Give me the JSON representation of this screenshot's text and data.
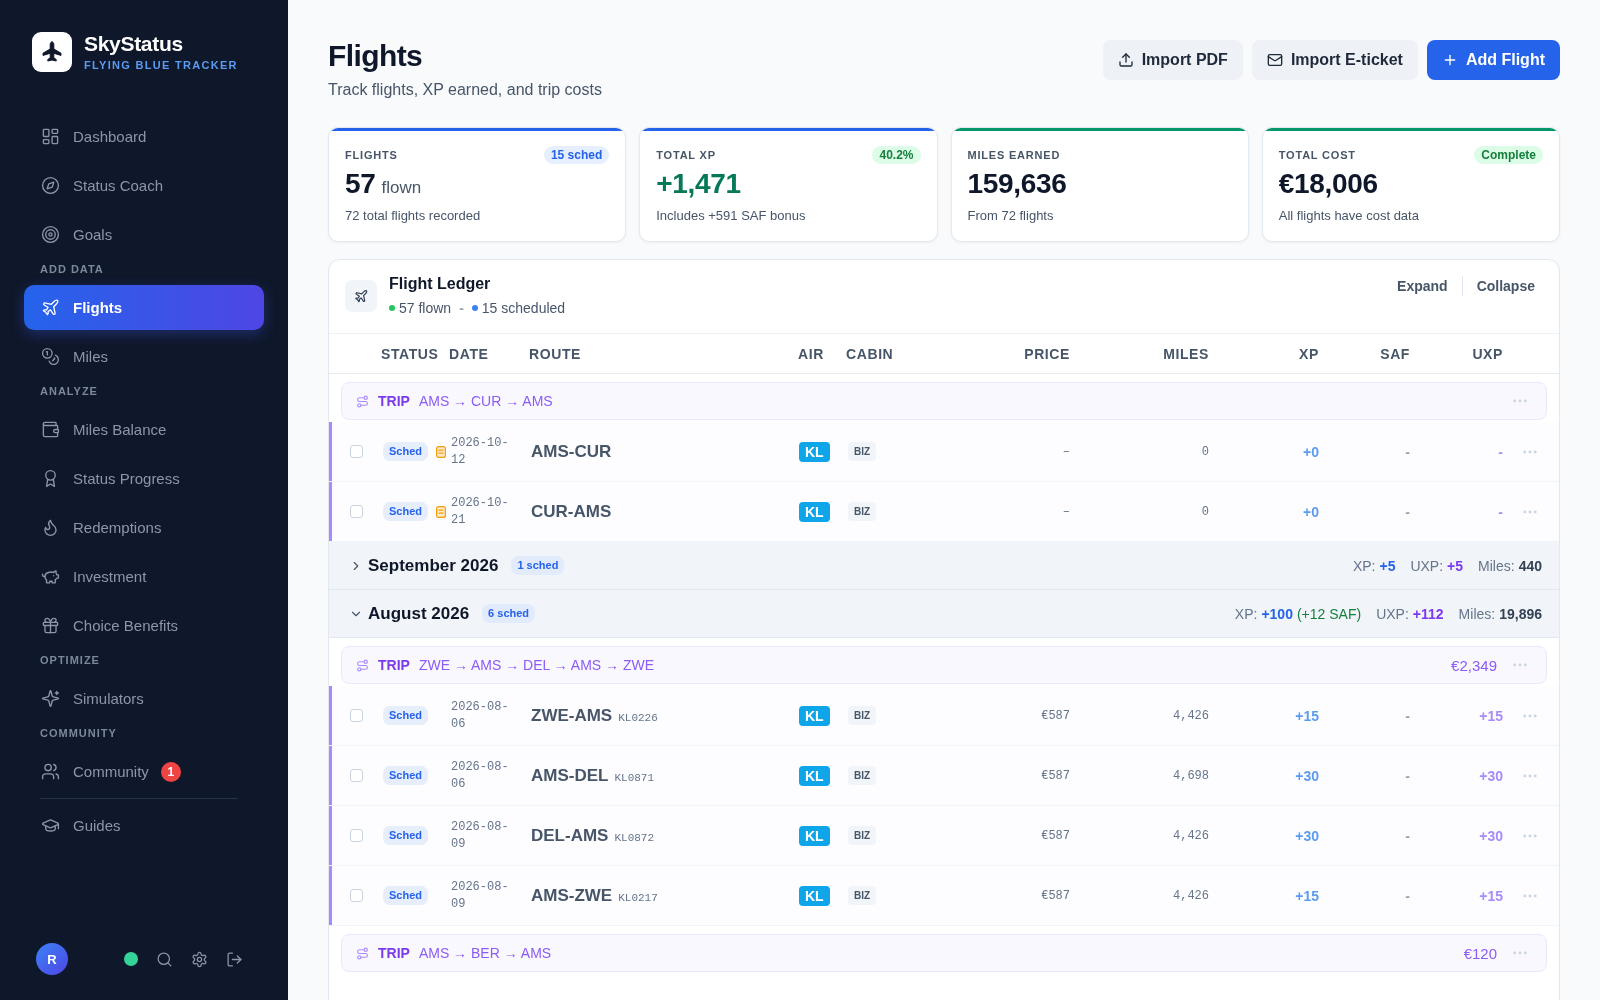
{
  "sidebar": {
    "brand": {
      "name": "SkyStatus",
      "tagline": "FLYING BLUE TRACKER"
    },
    "sections": [
      {
        "divider": false,
        "items": [
          {
            "label": "Dashboard",
            "selected": false
          },
          {
            "label": "Status Coach",
            "selected": false
          },
          {
            "label": "Goals",
            "selected": false
          }
        ]
      },
      {
        "heading": "ADD DATA",
        "divider": false,
        "items": [
          {
            "label": "Flights",
            "selected": true
          },
          {
            "label": "Miles",
            "selected": false
          }
        ]
      },
      {
        "heading": "ANALYZE",
        "divider": false,
        "items": [
          {
            "label": "Miles Balance",
            "selected": false
          },
          {
            "label": "Status Progress",
            "selected": false
          },
          {
            "label": "Redemptions",
            "selected": false
          },
          {
            "label": "Investment",
            "selected": false
          },
          {
            "label": "Choice Benefits",
            "selected": false
          }
        ]
      },
      {
        "heading": "OPTIMIZE",
        "divider": false,
        "items": [
          {
            "label": "Simulators",
            "selected": false
          }
        ]
      },
      {
        "heading": "COMMUNITY",
        "divider": false,
        "items": [
          {
            "label": "Community",
            "selected": false,
            "badge": "1"
          }
        ]
      },
      {
        "divider": true,
        "items": [
          {
            "label": "Guides",
            "selected": false
          }
        ]
      }
    ],
    "user": {
      "initial": "R",
      "online": true
    }
  },
  "header": {
    "title": "Flights",
    "subtitle": "Track flights, XP earned, and trip costs",
    "buttons": [
      {
        "label": "Import PDF",
        "kind": "secondary"
      },
      {
        "label": "Import E-ticket",
        "kind": "secondary"
      },
      {
        "label": "Add Flight",
        "kind": "primary"
      }
    ]
  },
  "stats": [
    {
      "kind": "neutral",
      "label": "FLIGHTS",
      "badge": {
        "text": "15 sched",
        "kind": "info"
      },
      "value": "57",
      "unit": "flown",
      "note": "72 total flights recorded",
      "color": "#2563eb"
    },
    {
      "kind": "positive",
      "label": "TOTAL XP",
      "badge": {
        "text": "40.2%",
        "kind": "success"
      },
      "value": "+1,471",
      "note": "Includes +591 SAF bonus",
      "color": "#2563eb"
    },
    {
      "kind": "neutral",
      "label": "MILES EARNED",
      "value": "159,636",
      "note": "From 72 flights",
      "color": "#059669"
    },
    {
      "kind": "neutral",
      "label": "TOTAL COST",
      "badge": {
        "text": "Complete",
        "kind": "success"
      },
      "value": "€18,006",
      "note": "All flights have cost data",
      "color": "#059669"
    }
  ],
  "ledger": {
    "title": "Flight Ledger",
    "counts": [
      {
        "text": "57 flown",
        "color": "#22c55e"
      },
      {
        "text": "15 scheduled",
        "color": "#3b82f6"
      }
    ],
    "separator": "-",
    "actions": [
      "Expand",
      "Collapse"
    ],
    "columns": [
      "STATUS",
      "DATE",
      "ROUTE",
      "AIR",
      "CABIN",
      "PRICE",
      "MILES",
      "XP",
      "SAF",
      "UXP"
    ],
    "rows": [
      {
        "kind": "trip",
        "label": "TRIP",
        "route": "AMS → CUR → AMS"
      },
      {
        "kind": "flight",
        "checked": false,
        "in_trip": true,
        "status": "Sched",
        "flagged": true,
        "date": "2026-10-12",
        "route": "AMS-CUR",
        "airline": "KL",
        "cabin": "BIZ",
        "price": "–",
        "miles": "0",
        "xp": "+0",
        "saf": "-",
        "uxp": "-"
      },
      {
        "kind": "flight",
        "checked": false,
        "in_trip": true,
        "status": "Sched",
        "flagged": true,
        "date": "2026-10-21",
        "route": "CUR-AMS",
        "airline": "KL",
        "cabin": "BIZ",
        "price": "–",
        "miles": "0",
        "xp": "+0",
        "saf": "-",
        "uxp": "-"
      },
      {
        "kind": "month",
        "title": "September 2026",
        "badge": "1 sched",
        "expanded": false,
        "summary": [
          {
            "label": "XP:",
            "value": "+5",
            "kind": "xp"
          },
          {
            "label": "UXP:",
            "value": "+5",
            "kind": "uxp"
          },
          {
            "label": "Miles:",
            "value": "440",
            "kind": "miles"
          }
        ]
      },
      {
        "kind": "month",
        "title": "August 2026",
        "badge": "6 sched",
        "expanded": true,
        "summary": [
          {
            "label": "XP:",
            "value": "+100",
            "extra": "(+12 SAF)",
            "kind": "xp"
          },
          {
            "label": "UXP:",
            "value": "+112",
            "kind": "uxp"
          },
          {
            "label": "Miles:",
            "value": "19,896",
            "kind": "miles"
          }
        ]
      },
      {
        "kind": "trip",
        "label": "TRIP",
        "route": "ZWE → AMS → DEL → AMS → ZWE",
        "price": "€2,349"
      },
      {
        "kind": "flight",
        "checked": false,
        "in_trip": true,
        "status": "Sched",
        "flagged": false,
        "date": "2026-08-06",
        "route": "ZWE-AMS",
        "flight_number": "KL0226",
        "airline": "KL",
        "cabin": "BIZ",
        "price": "€587",
        "miles": "4,426",
        "xp": "+15",
        "saf": "-",
        "uxp": "+15"
      },
      {
        "kind": "flight",
        "checked": false,
        "in_trip": true,
        "status": "Sched",
        "flagged": false,
        "date": "2026-08-06",
        "route": "AMS-DEL",
        "flight_number": "KL0871",
        "airline": "KL",
        "cabin": "BIZ",
        "price": "€587",
        "miles": "4,698",
        "xp": "+30",
        "saf": "-",
        "uxp": "+30"
      },
      {
        "kind": "flight",
        "checked": false,
        "in_trip": true,
        "status": "Sched",
        "flagged": false,
        "date": "2026-08-09",
        "route": "DEL-AMS",
        "flight_number": "KL0872",
        "airline": "KL",
        "cabin": "BIZ",
        "price": "€587",
        "miles": "4,426",
        "xp": "+30",
        "saf": "-",
        "uxp": "+30"
      },
      {
        "kind": "flight",
        "checked": false,
        "in_trip": true,
        "status": "Sched",
        "flagged": false,
        "date": "2026-08-09",
        "route": "AMS-ZWE",
        "flight_number": "KL0217",
        "airline": "KL",
        "cabin": "BIZ",
        "price": "€587",
        "miles": "4,426",
        "xp": "+15",
        "saf": "-",
        "uxp": "+15"
      },
      {
        "kind": "trip",
        "label": "TRIP",
        "route": "AMS → BER → AMS",
        "price": "€120"
      }
    ]
  }
}
